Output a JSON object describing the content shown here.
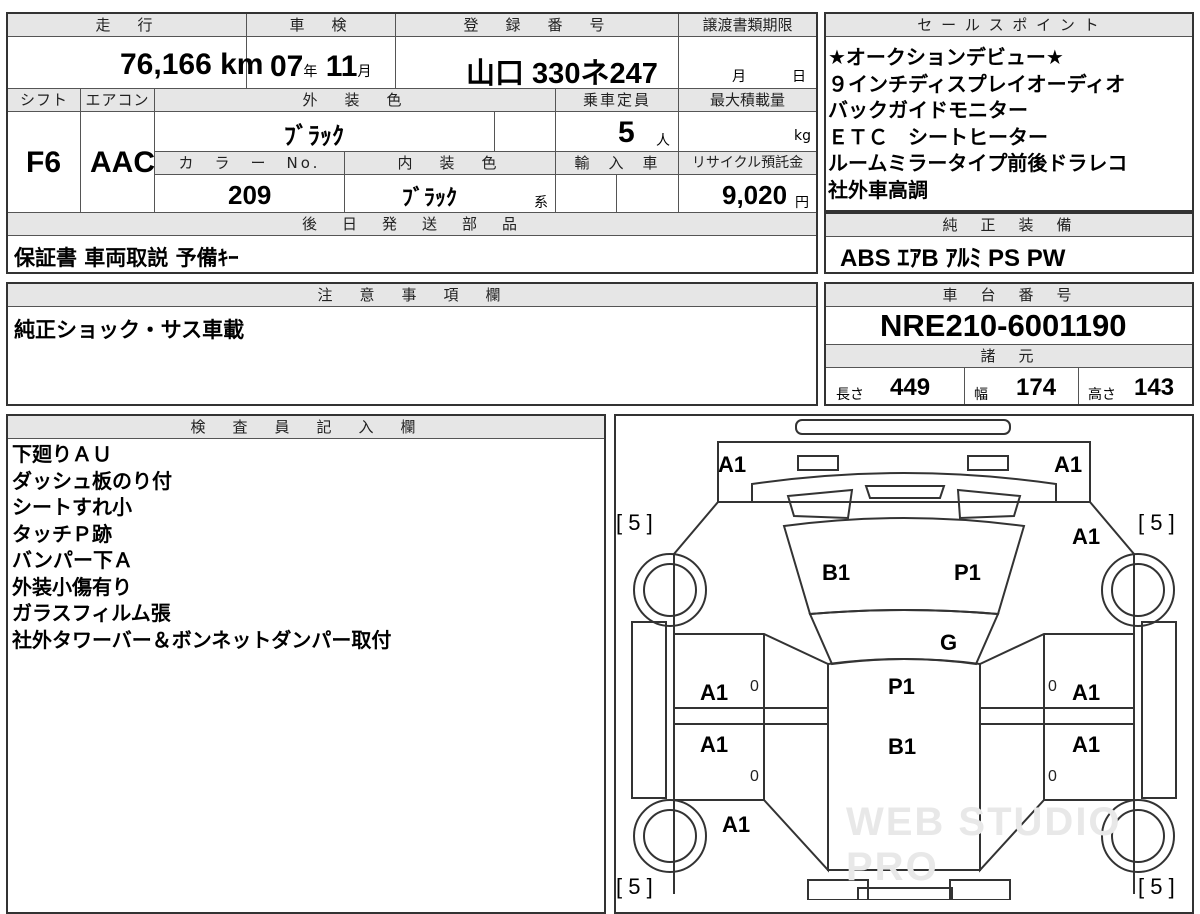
{
  "vehicle_info": {
    "headers": {
      "mileage": "走　行",
      "inspection": "車　検",
      "registration": "登　録　番　号",
      "transfer_deadline": "譲渡書類期限",
      "shift": "シフト",
      "aircon": "エアコン",
      "exterior_color": "外　装　色",
      "capacity": "乗車定員",
      "max_load": "最大積載量",
      "color_no": "カ　ラ　ー　No.",
      "interior_color": "内　装　色",
      "import": "輸　入　車",
      "recycle_fee": "リサイクル預託金",
      "later_parts": "後　日　発　送　部　品"
    },
    "mileage_value": "76,166",
    "mileage_unit": "km",
    "inspection_year": "07",
    "inspection_year_unit": "年",
    "inspection_month": "11",
    "inspection_month_unit": "月",
    "registration_number": "山口 330ネ247",
    "transfer_month_unit": "月",
    "transfer_day_unit": "日",
    "shift_value": "F6",
    "aircon_value": "AAC",
    "exterior_color_value": "ﾌﾞﾗｯｸ",
    "capacity_value": "5",
    "capacity_unit": "人",
    "max_load_unit": "kg",
    "color_no_value": "209",
    "interior_color_value": "ﾌﾞﾗｯｸ",
    "interior_color_suffix": "系",
    "recycle_fee_value": "9,020",
    "recycle_fee_unit": "円",
    "later_parts_value": "保証書 車両取説 予備ｷｰ"
  },
  "sales_points": {
    "header": "セ ー ル ス ポ イ ン ト",
    "lines": [
      "★オークションデビュー★",
      "９インチディスプレイオーディオ",
      "バックガイドモニター",
      "ＥＴＣ　シートヒーター",
      "ルームミラータイプ前後ドラレコ",
      "社外車高調"
    ]
  },
  "genuine_equipment": {
    "header": "純　正　装　備",
    "value": "ABS  ｴｱB  ｱﾙﾐ  PS  PW"
  },
  "caution": {
    "header": "注　意　事　項　欄",
    "value": "純正ショック・サス車載"
  },
  "chassis": {
    "header": "車　台　番　号",
    "number": "NRE210-6001190",
    "specs_header": "諸　元",
    "length_label": "長さ",
    "length_value": "449",
    "width_label": "幅",
    "width_value": "174",
    "height_label": "高さ",
    "height_value": "143"
  },
  "inspector": {
    "header": "検　査　員　記　入　欄",
    "lines": [
      "下廻りＡＵ",
      "ダッシュ板のり付",
      "シートすれ小",
      "タッチＰ跡",
      "バンパー下Ａ",
      "外装小傷有り",
      "ガラスフィルム張",
      "社外タワーバー＆ボンネットダンパー取付"
    ]
  },
  "car_diagram": {
    "marks": {
      "front_left": "A1",
      "front_right": "A1",
      "right_front_fender": "A1",
      "hood_left": "B1",
      "hood_right": "P1",
      "windshield": "G",
      "roof": "P1",
      "roof_rear": "B1",
      "left_front_door": "A1",
      "right_front_door": "A1",
      "left_rear_door": "A1",
      "right_rear_door": "A1",
      "left_rear_fender": "A1"
    },
    "tire_marks": {
      "front_left": "[ 5 ]",
      "front_right": "[ 5 ]",
      "rear_left": "[ 5 ]",
      "rear_right": "[ 5 ]"
    },
    "door_counts": {
      "lf": "0",
      "rf": "0",
      "lr": "0",
      "rr": "0"
    },
    "watermark": "WEB STUDIO PRO"
  }
}
